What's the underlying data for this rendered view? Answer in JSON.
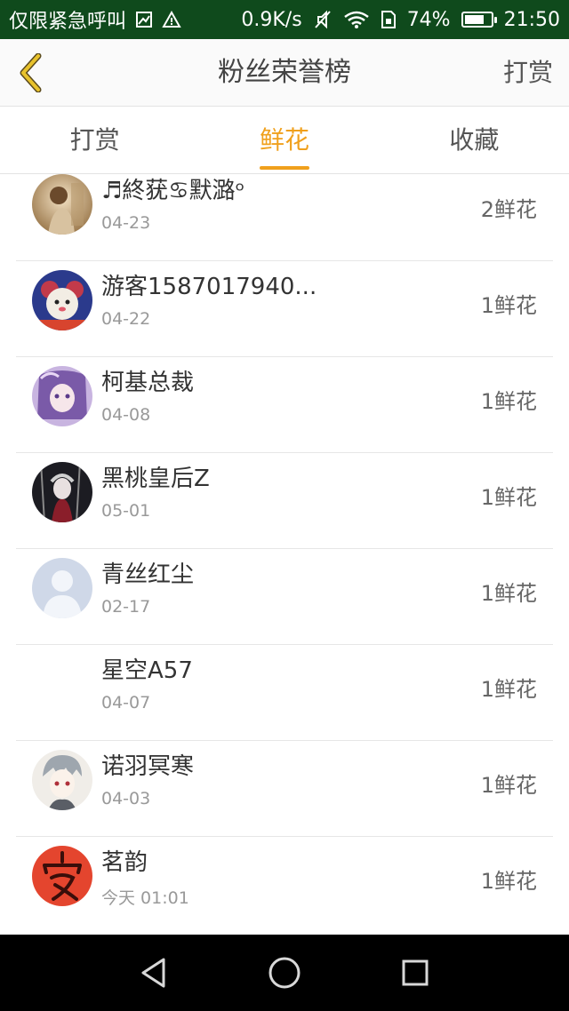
{
  "status_bar": {
    "carrier": "仅限紧急呼叫",
    "speed": "0.9K/s",
    "battery_percent": "74%",
    "time": "21:50",
    "battery_level": 0.74
  },
  "header": {
    "title": "粉丝荣誉榜",
    "action": "打赏"
  },
  "tabs": [
    {
      "label": "打赏",
      "active": false
    },
    {
      "label": "鲜花",
      "active": true
    },
    {
      "label": "收藏",
      "active": false
    }
  ],
  "fans": [
    {
      "name": "♬終莸♋默潞ᵒ",
      "date": "04-23",
      "flowers": "2鲜花",
      "avatar": "sepia-photo"
    },
    {
      "name": "游客1587017940...",
      "date": "04-22",
      "flowers": "1鲜花",
      "avatar": "cartoon-mouse"
    },
    {
      "name": "柯基总裁",
      "date": "04-08",
      "flowers": "1鲜花",
      "avatar": "anime-purple"
    },
    {
      "name": "黑桃皇后Z",
      "date": "05-01",
      "flowers": "1鲜花",
      "avatar": "dark-anime"
    },
    {
      "name": "青丝红尘",
      "date": "02-17",
      "flowers": "1鲜花",
      "avatar": "default-person"
    },
    {
      "name": "星空A57",
      "date": "04-07",
      "flowers": "1鲜花",
      "avatar": "none"
    },
    {
      "name": "诺羽冥寒",
      "date": "04-03",
      "flowers": "1鲜花",
      "avatar": "anime-silver"
    },
    {
      "name": "茗韵",
      "date": "今天 01:01",
      "flowers": "1鲜花",
      "avatar": "red-calligraphy"
    }
  ],
  "colors": {
    "accent": "#f0a01c",
    "status_bar": "#0f4a1c"
  },
  "icons": {
    "back": "chevron-left-icon",
    "nav_back": "triangle-back-icon",
    "nav_home": "circle-home-icon",
    "nav_recent": "square-recent-icon"
  }
}
